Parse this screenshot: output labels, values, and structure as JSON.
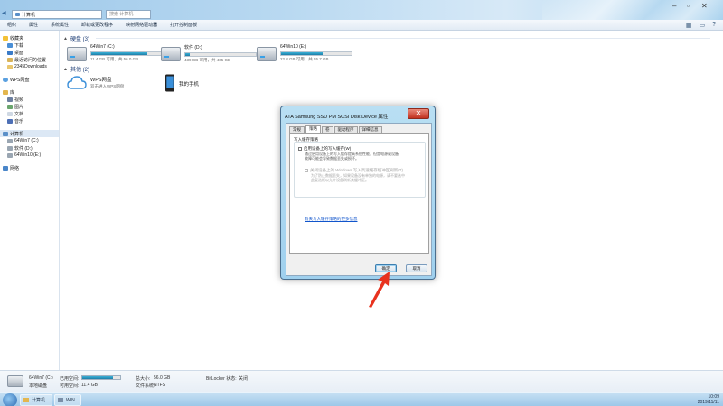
{
  "window": {
    "address": "计算机",
    "search_placeholder": "搜索 计算机"
  },
  "toolbar": {
    "items": [
      "组织",
      "属性",
      "系统属性",
      "卸载或更改程序",
      "映射网络驱动器",
      "打开控制面板"
    ]
  },
  "nav": {
    "favorites": "收藏夹",
    "fav_items": [
      "下载",
      "桌面",
      "最近访问的位置",
      "2345Downloads"
    ],
    "wps": "WPS网盘",
    "libraries": "库",
    "lib_items": [
      "视频",
      "图片",
      "文档",
      "音乐"
    ],
    "computer": "计算机",
    "comp_items": [
      "64Win7 (C:)",
      "软件 (D:)",
      "64Win10 (E:)"
    ],
    "network": "网络"
  },
  "content": {
    "hdd_header": "硬盘 (3)",
    "drives": [
      {
        "name": "64Win7 (C:)",
        "free": "11.4 GB 可用，共 56.0 GB",
        "used_fraction": 0.8
      },
      {
        "name": "软件 (D:)",
        "free": "439 GB 可用，共 465 GB",
        "used_fraction": 0.06
      },
      {
        "name": "64Win10 (E:)",
        "free": "22.8 GB 可用，共 55.7 GB",
        "used_fraction": 0.59
      }
    ],
    "other_header": "其他 (2)",
    "others": [
      {
        "name": "WPS网盘",
        "sub": "双击进入WPS网盘"
      },
      {
        "name": "我的手机",
        "sub": ""
      }
    ]
  },
  "dialog": {
    "title": "ATA Samsung SSD PM SCSI Disk Device 属性",
    "close": "✕",
    "tabs": [
      "常规",
      "策略",
      "卷",
      "驱动程序",
      "详细信息"
    ],
    "active_tab": 1,
    "group_title": "写入缓存策略",
    "opt1": "启用设备上的写入缓存(W)",
    "opt1_desc": [
      "通过启用设备上的写入缓存提高系统性能，但是电源或设备",
      "故障可能会导致数据丢失或损坏。"
    ],
    "opt2": "关闭设备上的 Windows 写入高速缓存缓冲区刷新(T)",
    "opt2_desc": [
      "为了防止数据丢失，如果设备没有单独的电源，请不要选中",
      "此复选框以允许设备刷新其缓冲区。"
    ],
    "link": "有关写入缓存策略的更多信息",
    "ok": "确定",
    "cancel": "取消"
  },
  "details": {
    "name": "64Win7 (C:)",
    "type": "本地磁盘",
    "used_label": "已用空间:",
    "used_fraction": 0.8,
    "free_label": "可用空间:",
    "free_value": "11.4 GB",
    "total_label": "总大小:",
    "total_value": "56.0 GB",
    "fs_label": "文件系统:",
    "fs_value": "NTFS",
    "bitlocker_label": "BitLocker 状态:",
    "bitlocker_value": "关闭"
  },
  "taskbar": {
    "tasks": [
      "计算机",
      "WIN"
    ],
    "time": "10:09",
    "date": "2019/11/11"
  },
  "colors": {
    "accent": "#1d7fa8",
    "arrow": "#e8321e"
  }
}
